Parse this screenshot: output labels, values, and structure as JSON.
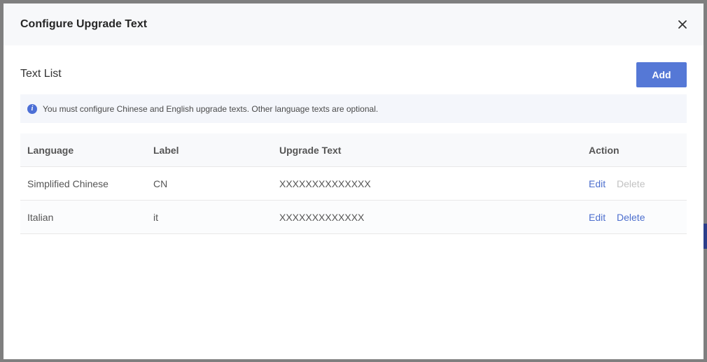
{
  "modal": {
    "title": "Configure Upgrade Text"
  },
  "section": {
    "title": "Text List",
    "add_label": "Add"
  },
  "notice": {
    "text": "You must configure Chinese and English upgrade texts. Other language texts are optional."
  },
  "table": {
    "headers": [
      "Language",
      "Label",
      "Upgrade Text",
      "Action"
    ],
    "rows": [
      {
        "language": "Simplified Chinese",
        "label": "CN",
        "text": "XXXXXXXXXXXXXX",
        "edit": "Edit",
        "delete": "Delete",
        "delete_enabled": false
      },
      {
        "language": "Italian",
        "label": "it",
        "text": "XXXXXXXXXXXXX",
        "edit": "Edit",
        "delete": "Delete",
        "delete_enabled": true
      }
    ]
  },
  "colors": {
    "primary": "#5578d6",
    "link": "#4d6fce",
    "disabled": "#c2c2c2"
  }
}
